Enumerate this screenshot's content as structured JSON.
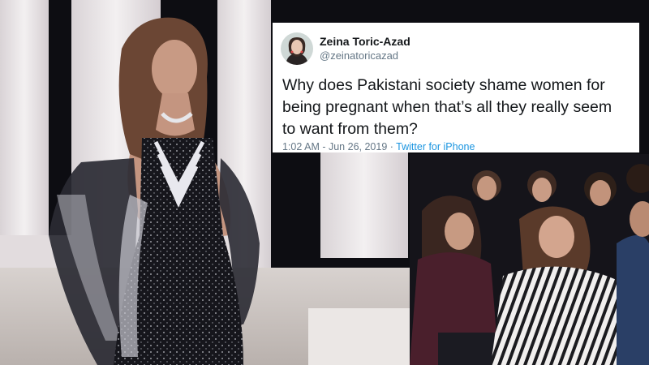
{
  "tweet": {
    "author_name": "Zeina Toric-Azad",
    "author_handle": "@zeinatoricazad",
    "text": "Why does Pakistani society shame women for being pregnant when that’s all they really seem to want from them?",
    "time": "1:02 AM",
    "separator1": " - ",
    "date": "Jun 26, 2019",
    "separator2": " · ",
    "source": "Twitter for iPhone",
    "avatar_icon": "profile-photo-icon"
  },
  "photo": {
    "subject": "runway-model-black-embellished-gown",
    "audience": "seated-audience-women",
    "colors": {
      "pillar": "#e8e4e6",
      "backdrop": "#0c0c10",
      "gown": "#15151b",
      "skin": "#c89a84",
      "hair": "#6b4634",
      "floor": "#cfc8c4"
    }
  }
}
